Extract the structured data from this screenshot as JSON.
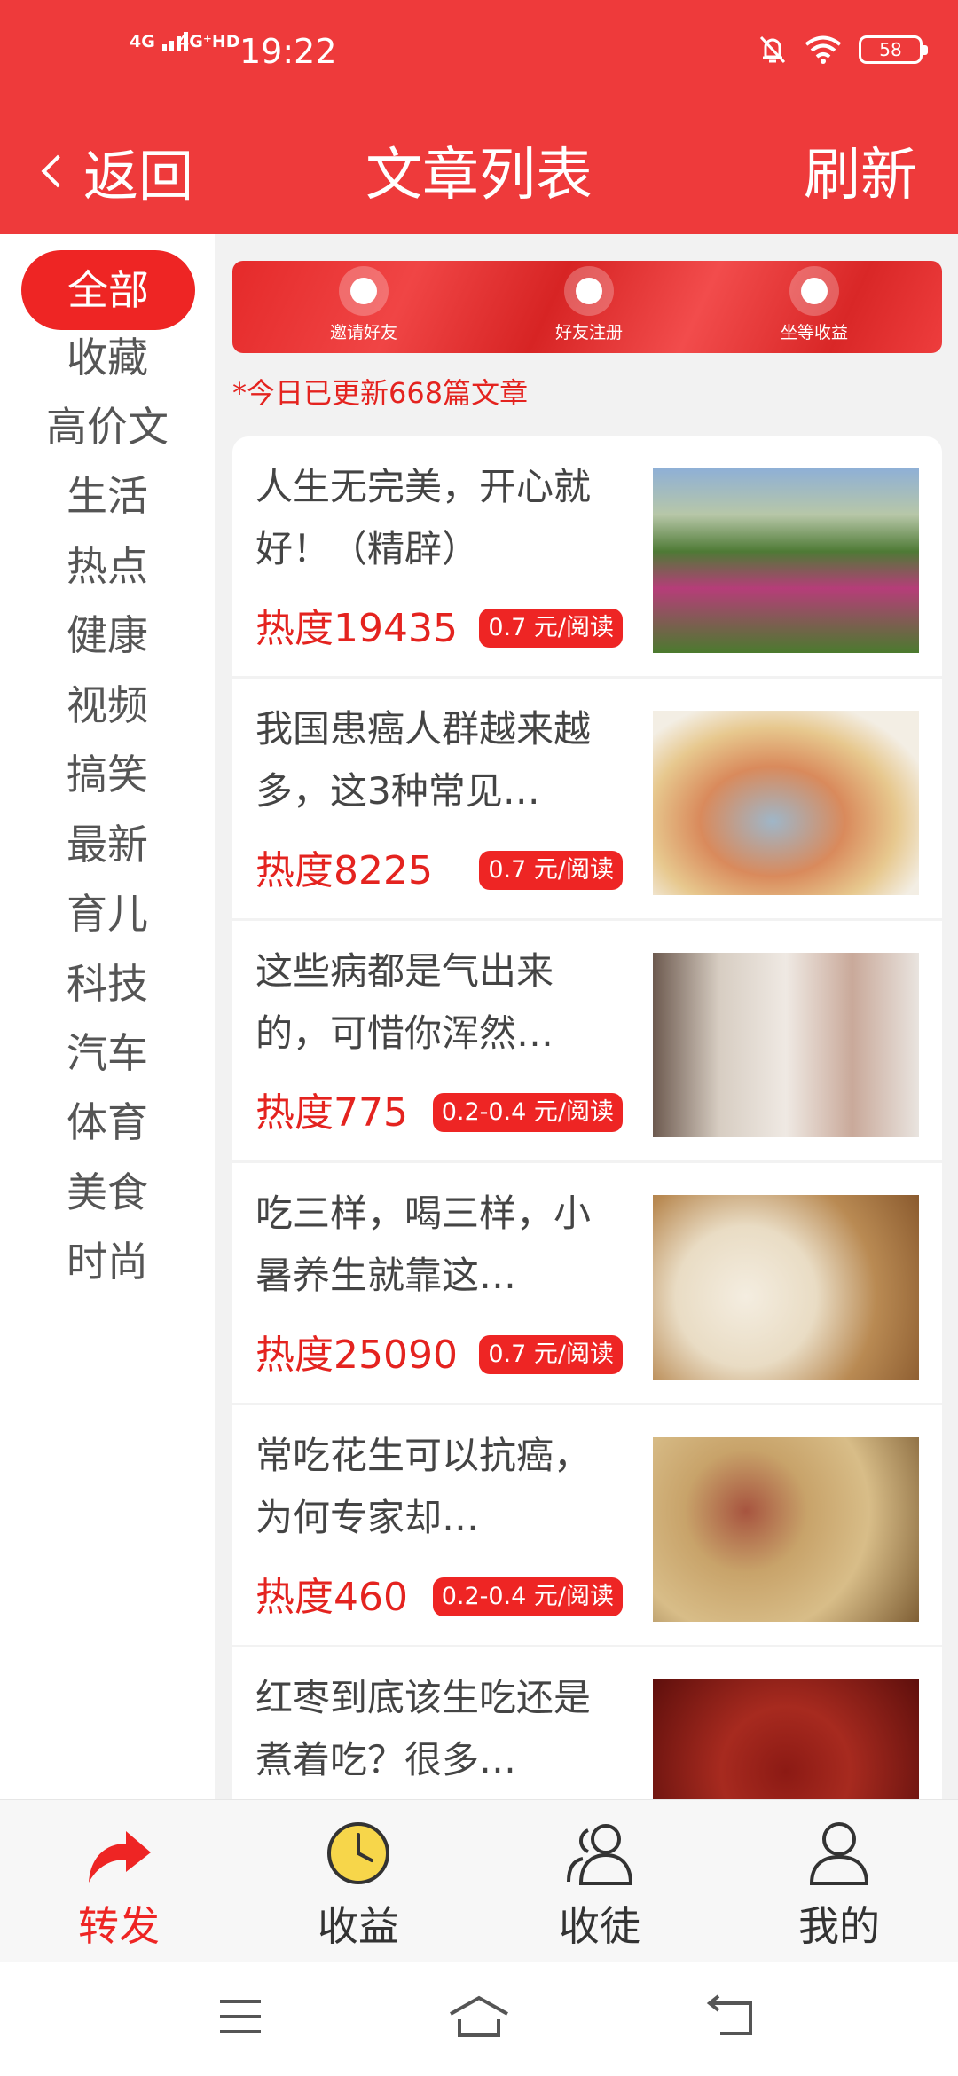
{
  "status_bar": {
    "network_1": "4G",
    "network_2": "4G⁺HD",
    "time": "19:22",
    "battery": "58"
  },
  "header": {
    "back_label": "返回",
    "title": "文章列表",
    "refresh_label": "刷新"
  },
  "sidebar": {
    "categories": [
      "全部",
      "收藏",
      "高价文",
      "生活",
      "热点",
      "健康",
      "视频",
      "搞笑",
      "最新",
      "育儿",
      "科技",
      "汽车",
      "体育",
      "美食",
      "时尚"
    ],
    "active": "全部"
  },
  "banner": {
    "items": [
      {
        "label": "邀请好友",
        "icon": "envelope-heart-icon"
      },
      {
        "label": "好友注册",
        "icon": "user-card-icon"
      },
      {
        "label": "坐等收益",
        "icon": "money-bag-icon"
      }
    ]
  },
  "update_notice": "*今日已更新668篇文章",
  "articles": [
    {
      "title": "人生无完美，开心就好！（精辟）",
      "hot": "热度19435",
      "price": "0.7 元/阅读",
      "image": "poppy-flowers"
    },
    {
      "title": "我国患癌人群越来越多，这3种常见…",
      "hot": "热度8225",
      "price": "0.7 元/阅读",
      "image": "moldy-food"
    },
    {
      "title": "这些病都是气出来的，可惜你浑然…",
      "hot": "热度775",
      "price": "0.2-0.4 元/阅读",
      "image": "upset-couple"
    },
    {
      "title": "吃三样，喝三样，小暑养生就靠这…",
      "hot": "热度25090",
      "price": "0.7 元/阅读",
      "image": "lotus-root"
    },
    {
      "title": "常吃花生可以抗癌，为何专家却…",
      "hot": "热度460",
      "price": "0.2-0.4 元/阅读",
      "image": "peanuts"
    },
    {
      "title": "红枣到底该生吃还是煮着吃？很多…",
      "hot": "",
      "price": "",
      "image": "red-dates"
    }
  ],
  "tabbar": {
    "tabs": [
      {
        "label": "转发",
        "icon": "share-arrow-icon",
        "active": true
      },
      {
        "label": "收益",
        "icon": "clock-icon",
        "active": false
      },
      {
        "label": "收徒",
        "icon": "users-icon",
        "active": false
      },
      {
        "label": "我的",
        "icon": "user-icon",
        "active": false
      }
    ]
  },
  "colors": {
    "brand_red": "#ee3a3b",
    "accent_red": "#ee2524",
    "text_red": "#e4231f"
  }
}
